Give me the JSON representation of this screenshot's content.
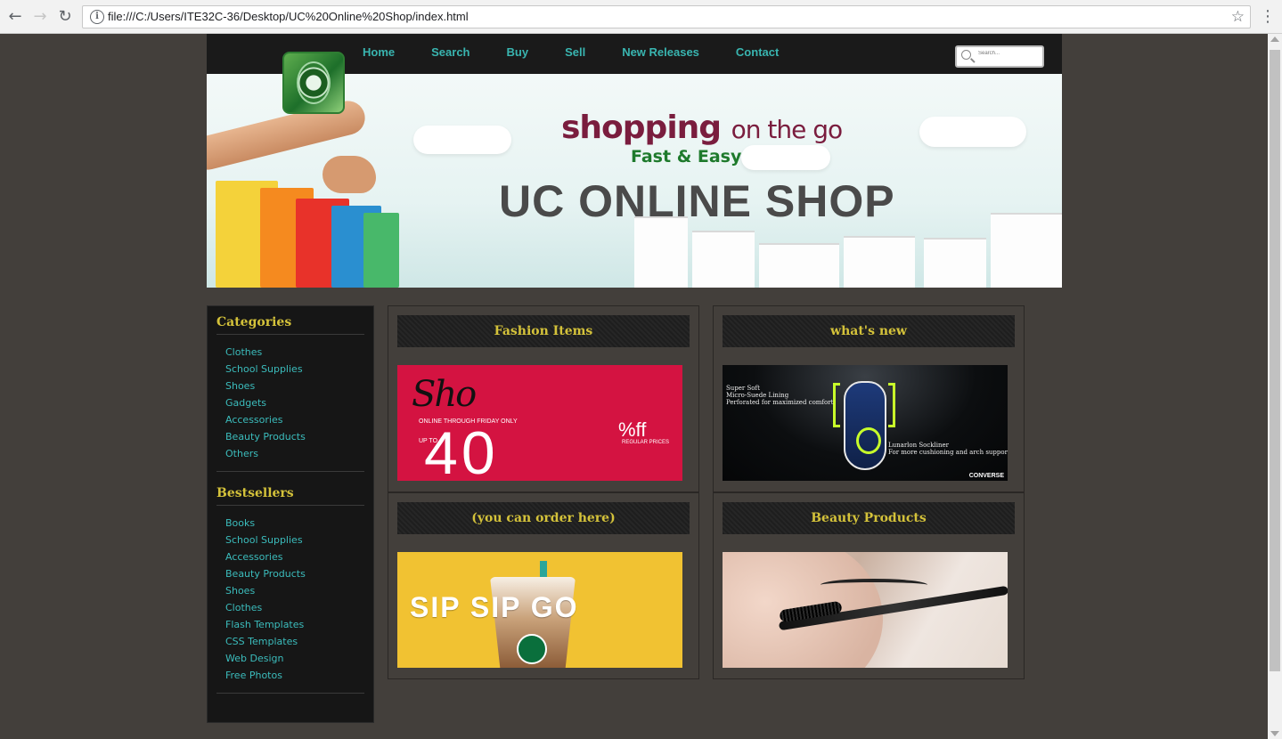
{
  "browser": {
    "back_icon": "arrow-left-icon",
    "forward_icon": "arrow-right-icon",
    "reload_icon": "reload-icon",
    "info_icon": "info-icon",
    "url": "file:///C:/Users/ITE32C-36/Desktop/UC%20Online%20Shop/index.html",
    "star_icon": "star-icon",
    "menu_icon": "kebab-menu-icon"
  },
  "nav": {
    "items": [
      "Home",
      "Search",
      "Buy",
      "Sell",
      "New Releases",
      "Contact"
    ],
    "search_placeholder": "Search..."
  },
  "colors": {
    "page_bg": "#433f3b",
    "nav_link": "#39b5b0",
    "heading_gold": "#d4c23a",
    "sidebar_link": "#3bbcbc",
    "header_bg": "#1a1a1a"
  },
  "banner": {
    "line1_bold": "shopping",
    "line1_light": "on the go",
    "line2": "Fast & Easy",
    "line3": "UC ONLINE SHOP"
  },
  "sidebar": {
    "categories_title": "Categories",
    "categories": [
      "Clothes",
      "School Supplies",
      "Shoes",
      "Gadgets",
      "Accessories",
      "Beauty Products",
      "Others"
    ],
    "bestsellers_title": "Bestsellers",
    "bestsellers": [
      "Books",
      "School Supplies",
      "Accessories",
      "Beauty Products",
      "Shoes",
      "Clothes",
      "Flash Templates",
      "CSS Templates",
      "Web Design",
      "Free Photos"
    ]
  },
  "panels": [
    {
      "title": "Fashion Items",
      "image": {
        "script": "Sho",
        "line": "ONLINE THROUGH FRIDAY ONLY",
        "upto": "UP TO",
        "number": "40",
        "off": "%ff",
        "regular": "REGULAR PRICES"
      }
    },
    {
      "title": "what's new",
      "image": {
        "text1": "Super Soft\nMicro-Suede Lining\nPerforated for maximized comfort",
        "text2": "Lunarlon Sockliner\nFor more cushioning and arch support",
        "brand": "CONVERSE"
      }
    },
    {
      "title": "(you can order here)",
      "image": {
        "text": "SIP SIP GO"
      }
    },
    {
      "title": "Beauty Products",
      "image": {}
    }
  ]
}
